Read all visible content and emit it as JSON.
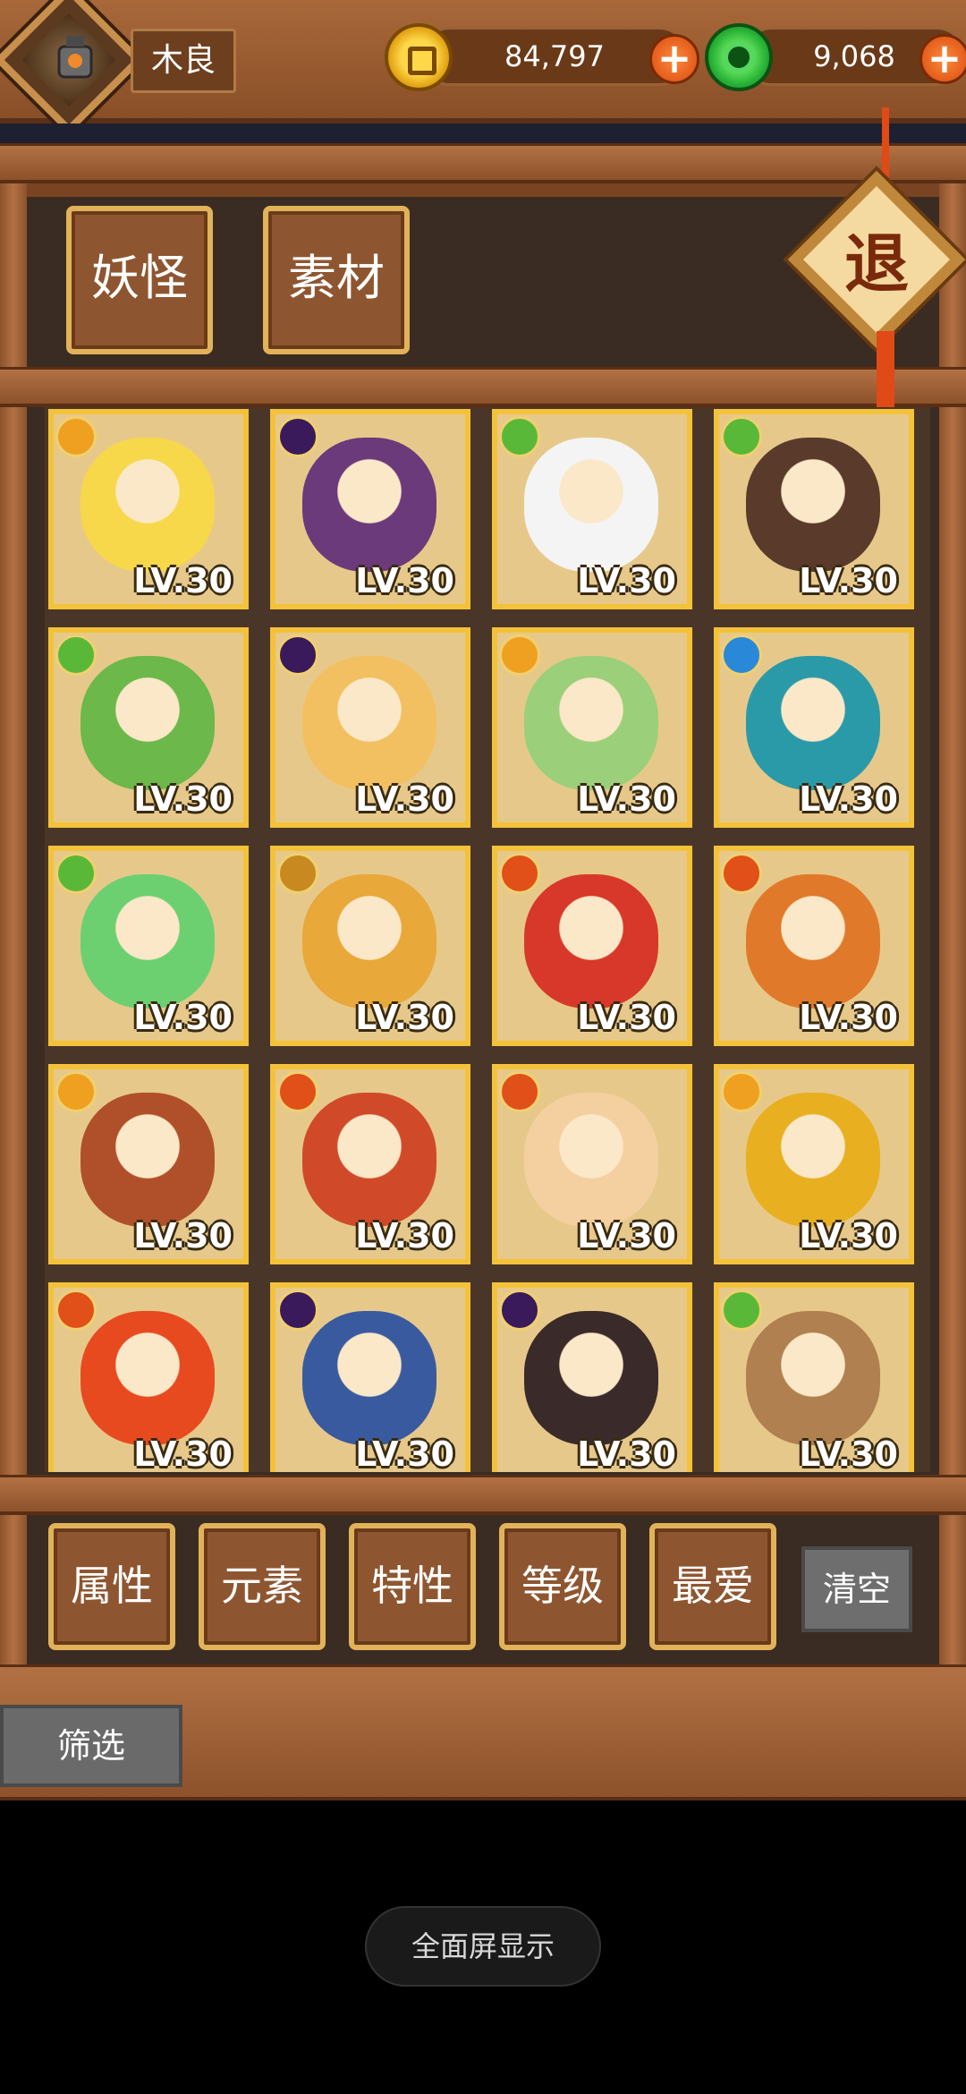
{
  "header": {
    "player_name": "木良",
    "coins": "84,797",
    "jade": "9,068",
    "plus_label": "+"
  },
  "categories": [
    {
      "label": "妖怪"
    },
    {
      "label": "素材"
    }
  ],
  "exit_label": "退",
  "monsters": [
    {
      "level": "LV.30",
      "element": "sun-icon",
      "tone": "#f6d84a"
    },
    {
      "level": "LV.30",
      "element": "moon-icon",
      "tone": "#6a3a7a"
    },
    {
      "level": "LV.30",
      "element": "leaf-icon",
      "tone": "#f4f4f4"
    },
    {
      "level": "LV.30",
      "element": "leaf-icon",
      "tone": "#5a3a2a"
    },
    {
      "level": "LV.30",
      "element": "leaf-icon",
      "tone": "#6cb84a"
    },
    {
      "level": "LV.30",
      "element": "moon-icon",
      "tone": "#f2c060"
    },
    {
      "level": "LV.30",
      "element": "sun-icon",
      "tone": "#9ccf7a"
    },
    {
      "level": "LV.30",
      "element": "water-icon",
      "tone": "#2a9aa8"
    },
    {
      "level": "LV.30",
      "element": "leaf-icon",
      "tone": "#6cd070"
    },
    {
      "level": "LV.30",
      "element": "earth-icon",
      "tone": "#e8a83a"
    },
    {
      "level": "LV.30",
      "element": "fire-icon",
      "tone": "#d8382a"
    },
    {
      "level": "LV.30",
      "element": "fire-icon",
      "tone": "#e07a2a"
    },
    {
      "level": "LV.30",
      "element": "sun-icon",
      "tone": "#b0502a"
    },
    {
      "level": "LV.30",
      "element": "fire-icon",
      "tone": "#d04a2a"
    },
    {
      "level": "LV.30",
      "element": "fire-icon",
      "tone": "#f4d0a0"
    },
    {
      "level": "LV.30",
      "element": "sun-icon",
      "tone": "#e8b020"
    },
    {
      "level": "LV.30",
      "element": "fire-icon",
      "tone": "#e84a20"
    },
    {
      "level": "LV.30",
      "element": "moon-icon",
      "tone": "#3a5aa0"
    },
    {
      "level": "LV.30",
      "element": "moon-icon",
      "tone": "#3a2a2a"
    },
    {
      "level": "LV.30",
      "element": "leaf-icon",
      "tone": "#b08050"
    }
  ],
  "element_colors": {
    "sun-icon": "#f0a020",
    "moon-icon": "#3a1a5a",
    "leaf-icon": "#5ab838",
    "water-icon": "#2a88d8",
    "fire-icon": "#e05018",
    "earth-icon": "#c88a20"
  },
  "filters": [
    {
      "label": "属性"
    },
    {
      "label": "元素"
    },
    {
      "label": "特性"
    },
    {
      "label": "等级"
    },
    {
      "label": "最爱"
    }
  ],
  "clear_label": "清空",
  "screen_label": "筛选",
  "fullscreen_label": "全面屏显示"
}
